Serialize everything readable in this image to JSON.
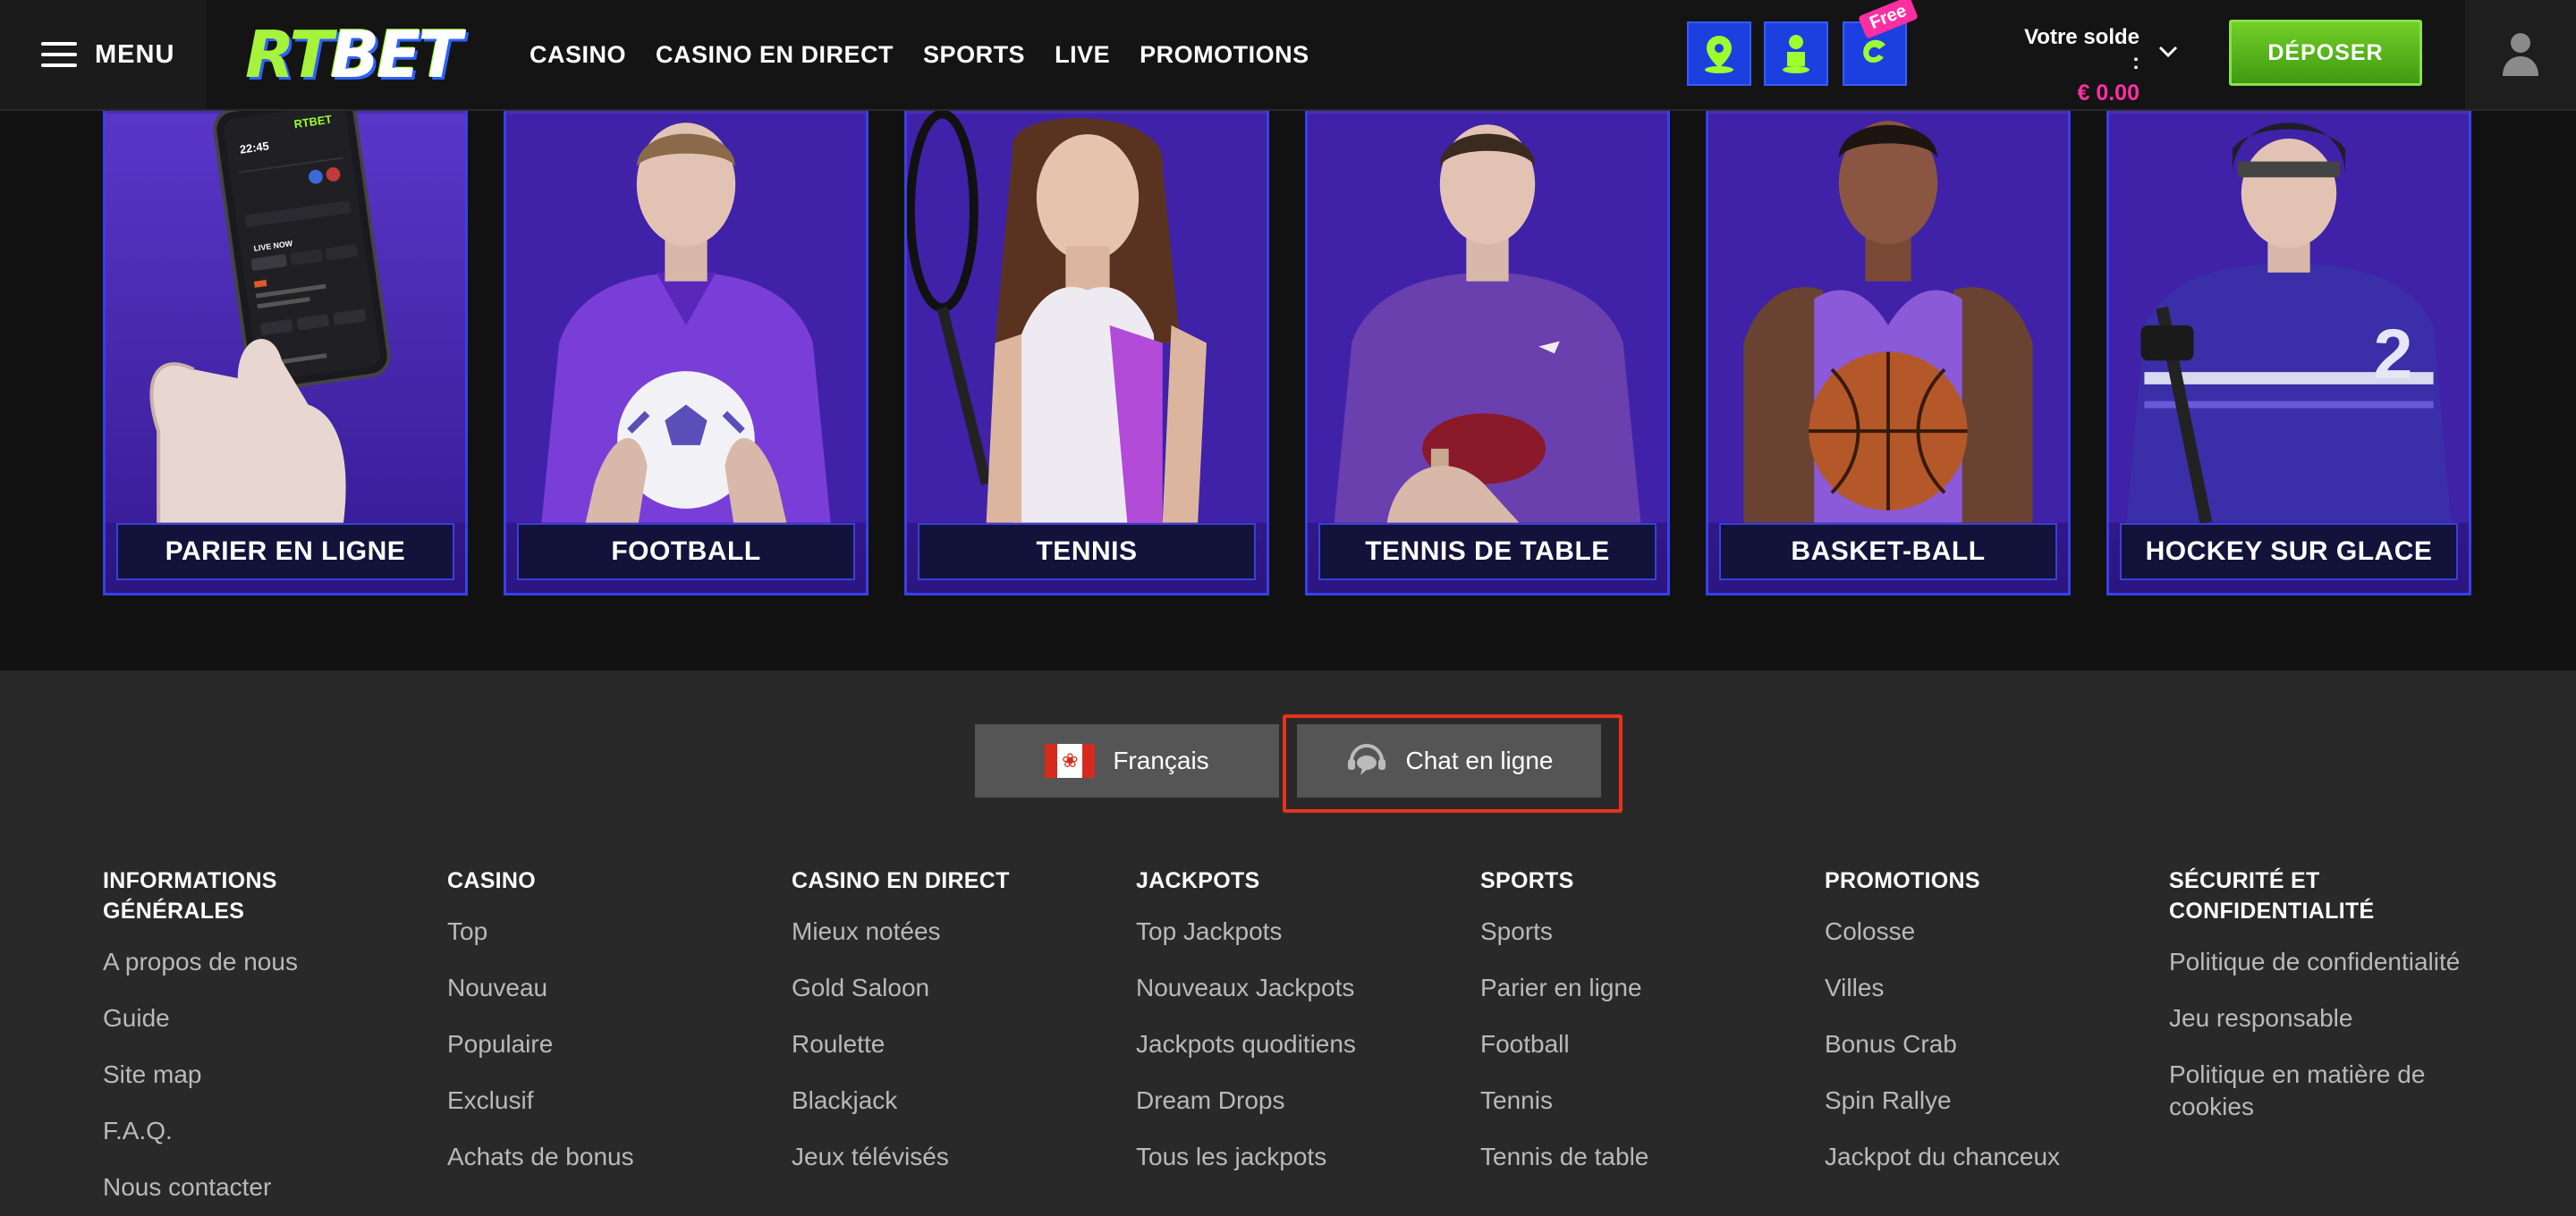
{
  "header": {
    "menu_label": "MENU",
    "logo": "RTBET",
    "nav": [
      "CASINO",
      "CASINO EN DIRECT",
      "SPORTS",
      "LIVE",
      "PROMOTIONS"
    ],
    "free_badge": "Free",
    "balance_label": "Votre solde :",
    "balance_amount": "€ 0.00",
    "deposit_label": "DÉPOSER"
  },
  "sport_cards": [
    {
      "label": "PARIER EN LIGNE"
    },
    {
      "label": "FOOTBALL"
    },
    {
      "label": "TENNIS"
    },
    {
      "label": "TENNIS DE TABLE"
    },
    {
      "label": "BASKET-BALL"
    },
    {
      "label": "HOCKEY SUR GLACE"
    }
  ],
  "phone": {
    "time": "22:45",
    "brand": "RTBET",
    "live_now": "LIVE NOW"
  },
  "footer": {
    "language": "Français",
    "chat": "Chat en ligne",
    "columns": [
      {
        "title": "INFORMATIONS GÉNÉRALES",
        "links": [
          "A propos de nous",
          "Guide",
          "Site map",
          "F.A.Q.",
          "Nous contacter"
        ]
      },
      {
        "title": "CASINO",
        "links": [
          "Top",
          "Nouveau",
          "Populaire",
          "Exclusif",
          "Achats de bonus"
        ]
      },
      {
        "title": "CASINO EN DIRECT",
        "links": [
          "Mieux notées",
          "Gold Saloon",
          "Roulette",
          "Blackjack",
          "Jeux télévisés"
        ]
      },
      {
        "title": "JACKPOTS",
        "links": [
          "Top Jackpots",
          "Nouveaux Jackpots",
          "Jackpots quoditiens",
          "Dream Drops",
          "Tous les jackpots"
        ]
      },
      {
        "title": "SPORTS",
        "links": [
          "Sports",
          "Parier en ligne",
          "Football",
          "Tennis",
          "Tennis de table"
        ]
      },
      {
        "title": "PROMOTIONS",
        "links": [
          "Colosse",
          "Villes",
          "Bonus Crab",
          "Spin Rallye",
          "Jackpot du chanceux"
        ]
      },
      {
        "title": "SÉCURITÉ ET CONFIDENTIALITÉ",
        "links": [
          "Politique de confidentialité",
          "Jeu responsable",
          "Politique en matière de cookies"
        ]
      }
    ]
  }
}
